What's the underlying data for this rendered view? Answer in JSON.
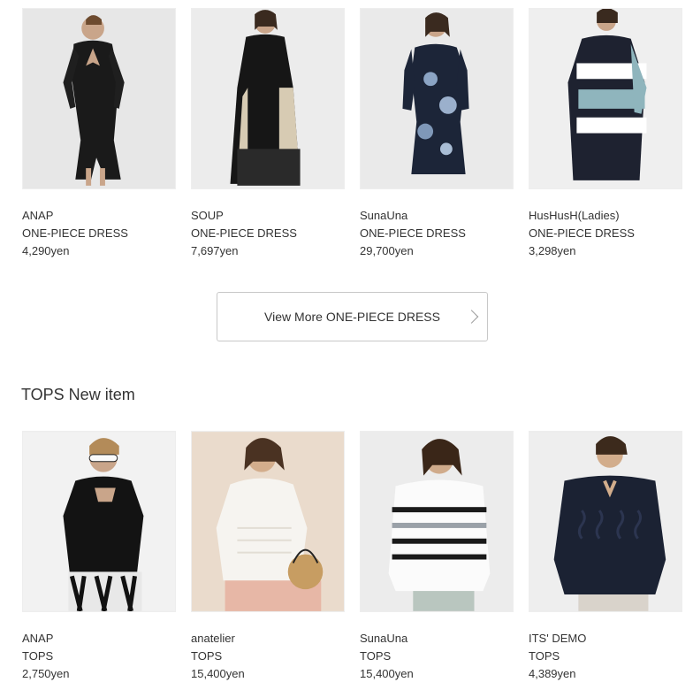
{
  "dress_section": {
    "items": [
      {
        "brand": "ANAP",
        "category": "ONE-PIECE DRESS",
        "price": "4,290yen",
        "image": "black-wrap-dress-photo"
      },
      {
        "brand": "SOUP",
        "category": "ONE-PIECE DRESS",
        "price": "7,697yen",
        "image": "black-beige-panel-dress-photo"
      },
      {
        "brand": "SunaUna",
        "category": "ONE-PIECE DRESS",
        "price": "29,700yen",
        "image": "navy-floral-dress-photo"
      },
      {
        "brand": "HusHusH(Ladies)",
        "category": "ONE-PIECE DRESS",
        "price": "3,298yen",
        "image": "colorblock-knit-dress-photo"
      }
    ],
    "view_more_label": "View More ONE-PIECE DRESS",
    "view_more_icon": "chevron-right-icon"
  },
  "tops_section": {
    "title": "TOPS New item",
    "items": [
      {
        "brand": "ANAP",
        "category": "TOPS",
        "price": "2,750yen",
        "image": "black-cutout-top-photo"
      },
      {
        "brand": "anatelier",
        "category": "TOPS",
        "price": "15,400yen",
        "image": "white-lace-blouse-photo"
      },
      {
        "brand": "SunaUna",
        "category": "TOPS",
        "price": "15,400yen",
        "image": "striped-knit-top-photo"
      },
      {
        "brand": "ITS' DEMO",
        "category": "TOPS",
        "price": "4,389yen",
        "image": "navy-cable-knit-photo"
      }
    ]
  }
}
